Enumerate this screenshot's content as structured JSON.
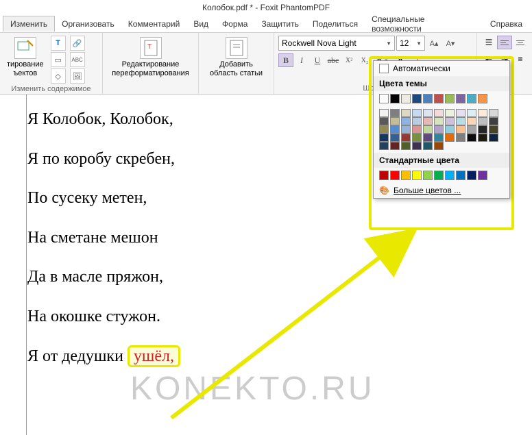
{
  "title": "Колобок.pdf * - Foxit PhantomPDF",
  "menu": {
    "edit": "Изменить",
    "organize": "Организовать",
    "comment": "Комментарий",
    "view": "Вид",
    "form": "Форма",
    "protect": "Защитить",
    "share": "Поделиться",
    "special": "Специальные возможности",
    "help": "Справка"
  },
  "ribbon": {
    "edit_objects": "тирование\nъектов",
    "edit_content_group": "Изменить содержимое",
    "edit_reformat": "Редактирование\nпереформатирования",
    "add_area": "Добавить\nобласть статьи",
    "font_group": "Шрифт",
    "font_name": "Rockwell Nova Light",
    "font_size": "12"
  },
  "color_popup": {
    "auto": "Автоматически",
    "theme": "Цвета темы",
    "standard": "Стандартные цвета",
    "more": "Больше цветов ...",
    "theme_row1": [
      "#ffffff",
      "#000000",
      "#eeece1",
      "#1f497d",
      "#4f81bd",
      "#c0504d",
      "#9bbb59",
      "#8064a2",
      "#4bacc6",
      "#f79646"
    ],
    "theme_shades": [
      [
        "#f2f2f2",
        "#7f7f7f",
        "#ddd9c3",
        "#c6d9f0",
        "#dbe5f1",
        "#f2dcdb",
        "#ebf1dd",
        "#e5e0ec",
        "#dbeef3",
        "#fdeada"
      ],
      [
        "#d8d8d8",
        "#595959",
        "#c4bd97",
        "#8db3e2",
        "#b8cce4",
        "#e5b9b7",
        "#d7e3bc",
        "#ccc1d9",
        "#b7dde8",
        "#fbd5b5"
      ],
      [
        "#bfbfbf",
        "#3f3f3f",
        "#938953",
        "#548dd4",
        "#95b3d7",
        "#d99694",
        "#c3d69b",
        "#b2a2c7",
        "#92cddc",
        "#fac08f"
      ],
      [
        "#a5a5a5",
        "#262626",
        "#494429",
        "#17365d",
        "#366092",
        "#953734",
        "#76923c",
        "#5f497a",
        "#31859b",
        "#e36c09"
      ],
      [
        "#7f7f7f",
        "#0c0c0c",
        "#1d1b10",
        "#0f243e",
        "#244061",
        "#632423",
        "#4f6128",
        "#3f3151",
        "#205867",
        "#974806"
      ]
    ],
    "standard_colors": [
      "#c00000",
      "#ff0000",
      "#ffc000",
      "#ffff00",
      "#92d050",
      "#00b050",
      "#00b0f0",
      "#0070c0",
      "#002060",
      "#7030a0"
    ]
  },
  "document": {
    "line1": "Я Колобок, Колобок,",
    "line2": "Я по коробу скребен,",
    "line3": "По сусеку метен,",
    "line4": "На сметане мешон",
    "line5": "Да в масле пряжон,",
    "line6": "На окошке стужон.",
    "line7_a": "Я от дедушки ",
    "line7_b": "ушёл,"
  },
  "watermark": "KONEKTO.RU"
}
